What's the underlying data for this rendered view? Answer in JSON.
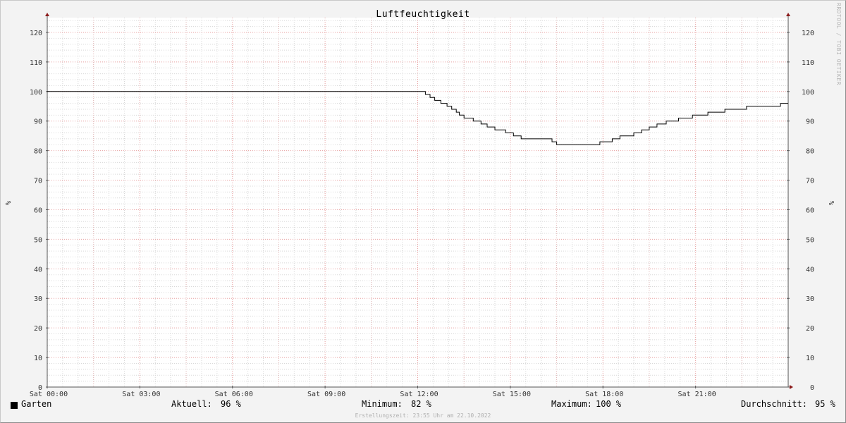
{
  "chart_data": {
    "type": "line",
    "title": "Luftfeuchtigkeit",
    "ylabel": "%",
    "ylim": [
      0,
      125
    ],
    "yticks": [
      0,
      10,
      20,
      30,
      40,
      50,
      60,
      70,
      80,
      90,
      100,
      110,
      120
    ],
    "xlim": [
      0,
      24
    ],
    "xtick_hours": [
      0,
      3,
      6,
      9,
      12,
      15,
      18,
      21
    ],
    "xtick_labels": [
      "Sat 00:00",
      "Sat 03:00",
      "Sat 06:00",
      "Sat 09:00",
      "Sat 12:00",
      "Sat 15:00",
      "Sat 18:00",
      "Sat 21:00"
    ],
    "grid": true,
    "series": [
      {
        "name": "Garten",
        "color": "#000000",
        "x_hours": [
          0,
          12.25,
          12.4,
          12.55,
          12.75,
          12.95,
          13.1,
          13.25,
          13.35,
          13.5,
          13.8,
          14.05,
          14.25,
          14.5,
          14.85,
          15.1,
          15.35,
          16.35,
          16.5,
          17.9,
          18.3,
          18.55,
          19.0,
          19.25,
          19.5,
          19.75,
          20.05,
          20.45,
          20.9,
          21.4,
          21.95,
          22.65,
          23.35,
          23.75,
          24.0
        ],
        "y": [
          100,
          99,
          98,
          97,
          96,
          95,
          94,
          93,
          92,
          91,
          90,
          89,
          88,
          87,
          86,
          85,
          84,
          83,
          82,
          83,
          84,
          85,
          86,
          87,
          88,
          89,
          90,
          91,
          92,
          93,
          94,
          95,
          95,
          96,
          96
        ]
      }
    ]
  },
  "legend": {
    "name": "Garten",
    "current_label": "Aktuell:",
    "current_value": "96 %",
    "min_label": "Minimum:",
    "min_value": "82 %",
    "max_label": "Maximum:",
    "max_value": "100 %",
    "avg_label": "Durchschnitt:",
    "avg_value": "95 %"
  },
  "watermark": "RRDTOOL / TOBI OETIKER",
  "footer": "Erstellungszeit: 23:55 Uhr am 22.10.2022",
  "colors": {
    "background": "#f3f3f3",
    "canvas": "#ffffff",
    "minor_grid": "#d8d8d8",
    "major_grid": "#e8a0a0",
    "axis": "#555555",
    "arrow": "#8b1a1a"
  }
}
